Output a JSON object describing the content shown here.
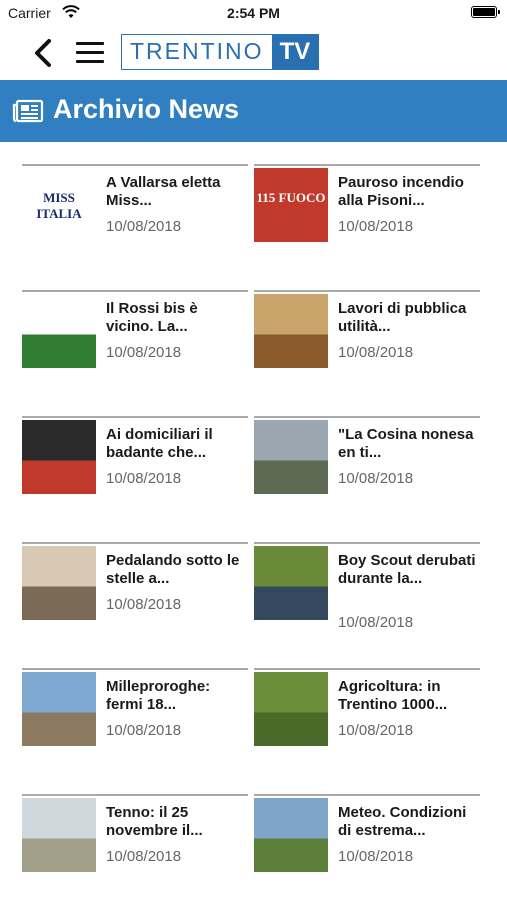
{
  "status_bar": {
    "carrier": "Carrier",
    "time": "2:54 PM"
  },
  "nav": {
    "logo_part1": "TRENTINO",
    "logo_part2": "TV"
  },
  "header": {
    "title": "Archivio News",
    "icon": "newspaper-icon"
  },
  "news": [
    {
      "title": "A Vallarsa eletta Miss...",
      "date": "10/08/2018",
      "thumb_text": "MISS ITALIA",
      "colors": [
        "#ffffff",
        "#1a2a6c"
      ]
    },
    {
      "title": "Pauroso incendio alla Pisoni...",
      "date": "10/08/2018",
      "thumb_text": "115 FUOCO",
      "colors": [
        "#c0392b",
        "#ffffff"
      ]
    },
    {
      "title": "Il Rossi bis è vicino. La...",
      "date": "10/08/2018",
      "colors": [
        "#ffffff",
        "#2e7d32"
      ]
    },
    {
      "title": "Lavori di pubblica utilità...",
      "date": "10/08/2018",
      "colors": [
        "#c8a46a",
        "#8b5a2b"
      ]
    },
    {
      "title": "Ai domiciliari il badante che...",
      "date": "10/08/2018",
      "colors": [
        "#2b2b2b",
        "#c0392b"
      ]
    },
    {
      "title": "\"La Cosina nonesa en ti...",
      "date": "10/08/2018",
      "colors": [
        "#9aa7b0",
        "#5d6b55"
      ]
    },
    {
      "title": "Pedalando sotto le stelle a...",
      "date": "10/08/2018",
      "colors": [
        "#d8c9b5",
        "#7a6a55"
      ]
    },
    {
      "title": "Boy Scout derubati durante la...",
      "date": "10/08/2018",
      "colors": [
        "#6a8a3a",
        "#34495e"
      ]
    },
    {
      "title": "Milleproroghe: fermi 18...",
      "date": "10/08/2018",
      "colors": [
        "#7fa9d1",
        "#8c7a62"
      ]
    },
    {
      "title": "Agricoltura: in Trentino 1000...",
      "date": "10/08/2018",
      "colors": [
        "#6b8e3a",
        "#4a6a2a"
      ]
    },
    {
      "title": "Tenno: il 25 novembre il...",
      "date": "10/08/2018",
      "colors": [
        "#cfd8dc",
        "#a3a08a"
      ]
    },
    {
      "title": "Meteo. Condizioni di estrema...",
      "date": "10/08/2018",
      "colors": [
        "#7fa5c8",
        "#5b7f3a"
      ]
    }
  ]
}
